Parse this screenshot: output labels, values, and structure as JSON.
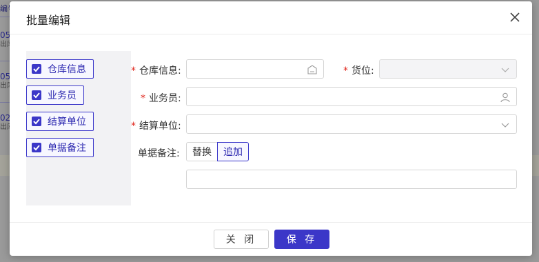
{
  "background": {
    "rows": [
      {
        "num": "05",
        "sub": "出库"
      },
      {
        "num": "05",
        "sub": "出库"
      },
      {
        "num": "02",
        "sub": "出库"
      }
    ],
    "header_fragment": "编号"
  },
  "modal": {
    "title": "批量编辑",
    "checkboxes": [
      {
        "label": "仓库信息",
        "checked": true
      },
      {
        "label": "业务员",
        "checked": true
      },
      {
        "label": "结算单位",
        "checked": true
      },
      {
        "label": "单据备注",
        "checked": true
      }
    ],
    "fields": {
      "warehouse": {
        "label": "仓库信息:",
        "required": true,
        "value": ""
      },
      "location": {
        "label": "货位:",
        "required": true,
        "value": ""
      },
      "salesman": {
        "label": "业务员:",
        "required": true,
        "value": ""
      },
      "settlement": {
        "label": "结算单位:",
        "required": true,
        "value": ""
      },
      "remark": {
        "label": "单据备注:",
        "value": ""
      }
    },
    "remark_modes": {
      "replace": "替换",
      "append": "追加",
      "selected": "追加"
    },
    "footer": {
      "close_label": "关 闭",
      "save_label": "保 存"
    }
  },
  "colors": {
    "accent": "#3b37c8",
    "required": "#e0261d"
  }
}
